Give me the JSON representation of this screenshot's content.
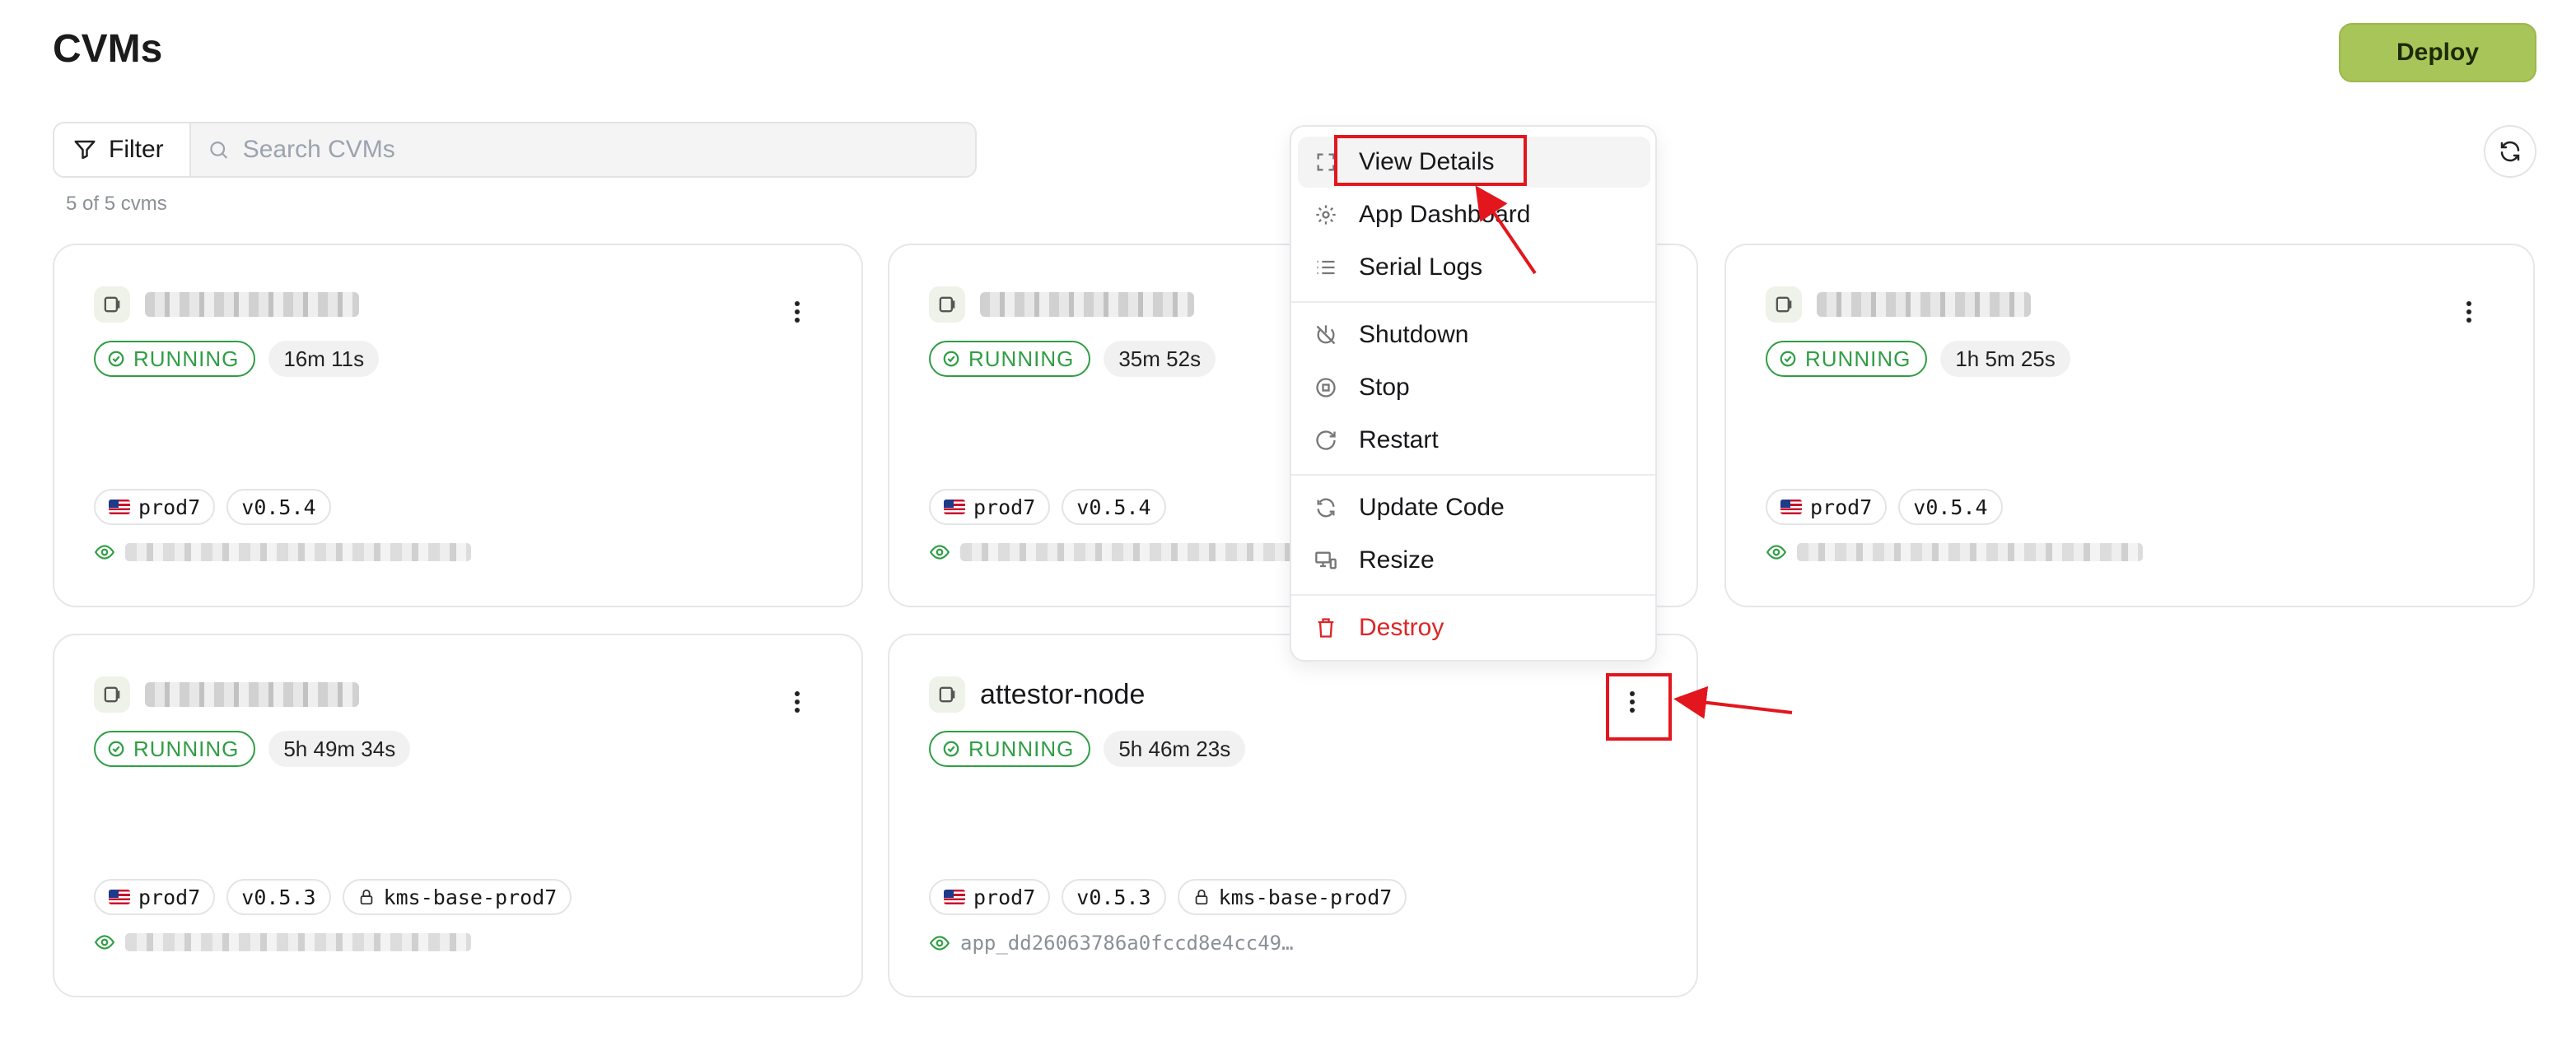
{
  "header": {
    "title": "CVMs",
    "deploy_label": "Deploy"
  },
  "toolbar": {
    "filter_label": "Filter",
    "search_placeholder": "Search CVMs",
    "count_text": "5 of 5 cvms"
  },
  "cards": [
    {
      "name": "",
      "status": "RUNNING",
      "uptime": "16m 11s",
      "tags": [
        "prod7",
        "v0.5.4"
      ],
      "kms": "",
      "app_id": ""
    },
    {
      "name": "",
      "status": "RUNNING",
      "uptime": "35m 52s",
      "tags": [
        "prod7",
        "v0.5.4"
      ],
      "kms": "",
      "app_id": ""
    },
    {
      "name": "",
      "status": "RUNNING",
      "uptime": "1h 5m 25s",
      "tags": [
        "prod7",
        "v0.5.4"
      ],
      "kms": "",
      "app_id": ""
    },
    {
      "name": "",
      "status": "RUNNING",
      "uptime": "5h 49m 34s",
      "tags": [
        "prod7",
        "v0.5.3"
      ],
      "kms": "kms-base-prod7",
      "app_id": ""
    },
    {
      "name": "attestor-node",
      "status": "RUNNING",
      "uptime": "5h 46m 23s",
      "tags": [
        "prod7",
        "v0.5.3"
      ],
      "kms": "kms-base-prod7",
      "app_id": "app_dd26063786a0fccd8e4cc49…"
    }
  ],
  "menu": {
    "items": [
      "View Details",
      "App Dashboard",
      "Serial Logs",
      "Shutdown",
      "Stop",
      "Restart",
      "Update Code",
      "Resize",
      "Destroy"
    ]
  },
  "colors": {
    "accent": "#a8c55a",
    "running": "#2f9e44",
    "danger": "#dc2626",
    "annotation": "#e3161d"
  },
  "icons": [
    "filter-icon",
    "search-icon",
    "refresh-icon",
    "app-icon",
    "kebab-icon",
    "check-circle-icon",
    "flag-us-icon",
    "lock-icon",
    "eye-icon",
    "expand-icon",
    "gear-icon",
    "list-icon",
    "power-off-icon",
    "stop-icon",
    "restart-icon",
    "update-icon",
    "resize-icon",
    "trash-icon"
  ]
}
